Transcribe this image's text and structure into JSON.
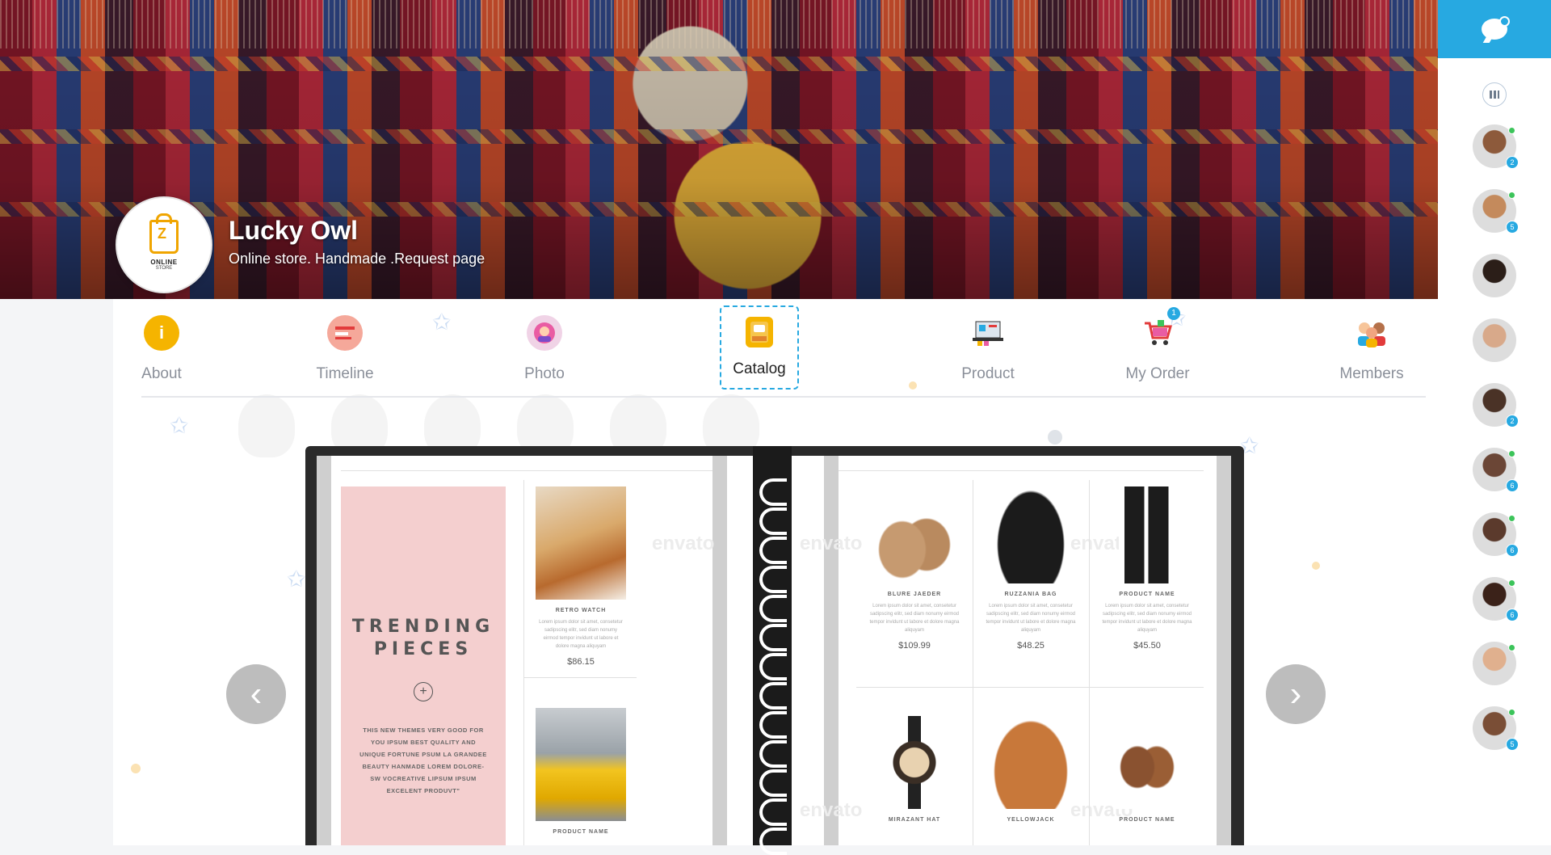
{
  "page": {
    "store_name": "Lucky Owl",
    "store_subtitle": "Online store. Handmade .Request page",
    "logo_line1": "ONLINE",
    "logo_line2": "STORE"
  },
  "tabs": [
    {
      "label": "About",
      "icon": "info-icon",
      "active": false
    },
    {
      "label": "Timeline",
      "icon": "timeline-icon",
      "active": false
    },
    {
      "label": "Photo",
      "icon": "photo-icon",
      "active": false
    },
    {
      "label": "Catalog",
      "icon": "catalog-icon",
      "active": true
    },
    {
      "label": "Product",
      "icon": "product-icon",
      "active": false
    },
    {
      "label": "My Order",
      "icon": "cart-icon",
      "active": false,
      "badge": "1"
    },
    {
      "label": "Members",
      "icon": "members-icon",
      "active": false
    }
  ],
  "catalog": {
    "left_page": {
      "heading_line1": "TRENDING",
      "heading_line2": "PIECES",
      "description": "THIS NEW THEMES VERY GOOD FOR YOU IPSUM BEST QUALITY AND UNIQUE FORTUNE PSUM LA GRANDEE BEAUTY HANMADE LOREM DOLORE-SW VOCREATIVE LIPSUM IPSUM EXCELENT PRODUVT\"",
      "products": [
        {
          "name": "RETRO WATCH",
          "price": "$86.15"
        },
        {
          "name": "PRODUCT NAME",
          "price": ""
        }
      ]
    },
    "right_page": {
      "products": [
        {
          "name": "BLURE JAEDER",
          "price": "$109.99"
        },
        {
          "name": "RUZZANIA BAG",
          "price": "$48.25"
        },
        {
          "name": "PRODUCT NAME",
          "price": "$45.50"
        },
        {
          "name": "MIRAZANT HAT",
          "price": ""
        },
        {
          "name": "YELLOWJACK",
          "price": ""
        },
        {
          "name": "PRODUCT NAME",
          "price": ""
        }
      ]
    },
    "lorem": "Lorem ipsum dolor sit amet, consetetur sadipscing elitr, sed diam nonumy eirmod tempor invidunt ut labore et dolore magna aliquyam",
    "watermark": "envato"
  },
  "rail": {
    "contacts": [
      {
        "badge": "2",
        "online": true
      },
      {
        "badge": "5",
        "online": true
      },
      {
        "badge": "",
        "online": false
      },
      {
        "badge": "",
        "online": false
      },
      {
        "badge": "2",
        "online": false
      },
      {
        "badge": "6",
        "online": true
      },
      {
        "badge": "6",
        "online": true
      },
      {
        "badge": "6",
        "online": true
      },
      {
        "badge": "",
        "online": true
      },
      {
        "badge": "5",
        "online": true
      }
    ]
  },
  "colors": {
    "accent": "#27a9e1",
    "about_icon": "#f5b400",
    "online": "#3cc45a"
  }
}
